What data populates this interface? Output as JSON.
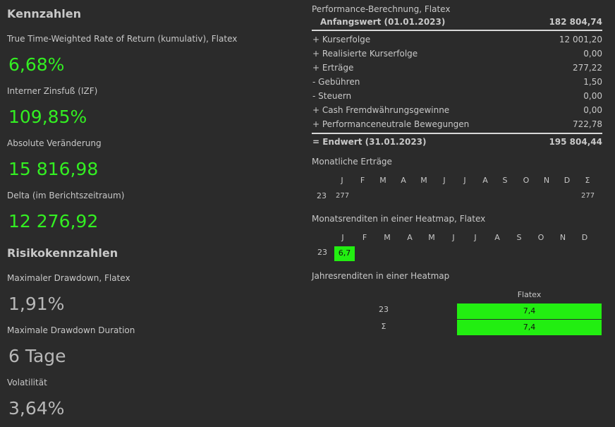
{
  "left": {
    "kennzahlen_title": "Kennzahlen",
    "ttwror_label": "True Time-Weighted Rate of Return (kumulativ), Flatex",
    "ttwror_value": "6,68%",
    "izf_label": "Interner Zinsfuß (IZF)",
    "izf_value": "109,85%",
    "abs_label": "Absolute Veränderung",
    "abs_value": "15 816,98",
    "delta_label": "Delta (im Berichtszeitraum)",
    "delta_value": "12 276,92",
    "risk_title": "Risikokennzahlen",
    "maxdd_label": "Maximaler Drawdown, Flatex",
    "maxdd_value": "1,91%",
    "maxddd_label": "Maximale Drawdown Duration",
    "maxddd_value": "6 Tage",
    "vol_label": "Volatilität",
    "vol_value": "3,64%"
  },
  "perf": {
    "title": "Performance-Berechnung, Flatex",
    "start_label": "Anfangswert (01.01.2023)",
    "start_value": "182 804,74",
    "rows": [
      {
        "label": "+ Kurserfolge",
        "value": "12 001,20"
      },
      {
        "label": "+ Realisierte Kurserfolge",
        "value": "0,00"
      },
      {
        "label": "+ Erträge",
        "value": "277,22"
      },
      {
        "label": "-  Gebühren",
        "value": "1,50"
      },
      {
        "label": "-  Steuern",
        "value": "0,00"
      },
      {
        "label": "+ Cash Fremdwährungsgewinne",
        "value": "0,00"
      },
      {
        "label": "+ Performanceneutrale Bewegungen",
        "value": "722,78"
      }
    ],
    "end_label": "= Endwert (31.01.2023)",
    "end_value": "195 804,44"
  },
  "monthly_income": {
    "title": "Monatliche Erträge",
    "months": [
      "J",
      "F",
      "M",
      "A",
      "M",
      "J",
      "J",
      "A",
      "S",
      "O",
      "N",
      "D",
      "Σ"
    ],
    "year": "23",
    "jan_value": "277",
    "sum_value": "277"
  },
  "heatmap_month": {
    "title": "Monatsrenditen in einer Heatmap, Flatex",
    "months": [
      "J",
      "F",
      "M",
      "A",
      "M",
      "J",
      "J",
      "A",
      "S",
      "O",
      "N",
      "D"
    ],
    "year": "23",
    "jan_value": "6,7",
    "color": "#22ee11"
  },
  "heatmap_year": {
    "title": "Jahresrenditen in einer Heatmap",
    "column": "Flatex",
    "rows": [
      {
        "label": "23",
        "value": "7,4"
      },
      {
        "label": "Σ",
        "value": "7,4"
      }
    ]
  }
}
